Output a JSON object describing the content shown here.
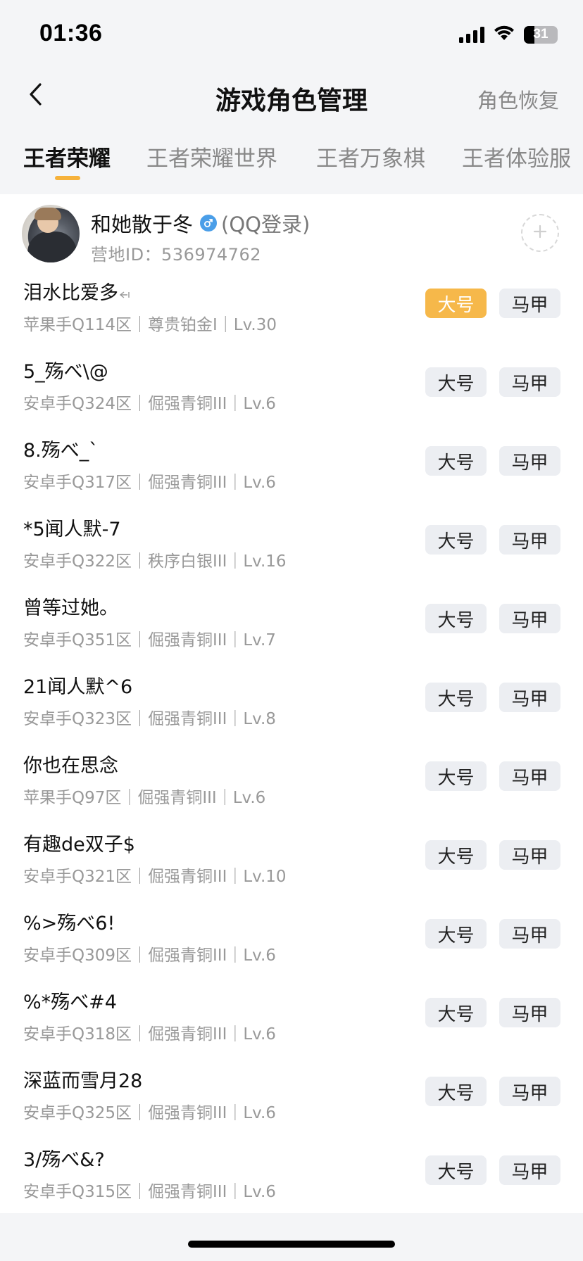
{
  "status_bar": {
    "time": "01:36",
    "battery": "31",
    "battery_level": 0.31,
    "icons": [
      "signal-icon",
      "wifi-icon",
      "battery-icon"
    ]
  },
  "header": {
    "back_icon": "chevron-left-icon",
    "title": "游戏角色管理",
    "right_action": "角色恢复"
  },
  "tabs": [
    {
      "label": "王者荣耀",
      "active": true
    },
    {
      "label": "王者荣耀世界",
      "active": false
    },
    {
      "label": "王者万象棋",
      "active": false
    },
    {
      "label": "王者体验服",
      "active": false
    }
  ],
  "profile": {
    "nickname": "和她散于冬",
    "gender_icon": "male-icon",
    "login_type": "(QQ登录)",
    "camp_id": "营地ID：536974762",
    "add_icon": "plus-icon"
  },
  "labels": {
    "main": "大号",
    "alt": "马甲"
  },
  "colors": {
    "accent": "#f6b84a",
    "tab_indicator": "#f6b23b",
    "gender_icon": "#4a9ee8"
  },
  "roles": [
    {
      "name": "泪水比爱多",
      "meta": "苹果手Q114区｜尊贵铂金I｜Lv.30",
      "main_selected": true
    },
    {
      "name": "5_殇べ\\@",
      "meta": "安卓手Q324区｜倔强青铜III｜Lv.6",
      "main_selected": false
    },
    {
      "name": "8.殇べ_`",
      "meta": "安卓手Q317区｜倔强青铜III｜Lv.6",
      "main_selected": false
    },
    {
      "name": "*5闻人默-7",
      "meta": "安卓手Q322区｜秩序白银III｜Lv.16",
      "main_selected": false
    },
    {
      "name": "曾等过她。",
      "meta": "安卓手Q351区｜倔强青铜III｜Lv.7",
      "main_selected": false
    },
    {
      "name": "21闻人默^6",
      "meta": "安卓手Q323区｜倔强青铜III｜Lv.8",
      "main_selected": false
    },
    {
      "name": "你也在思念",
      "meta": "苹果手Q97区｜倔强青铜III｜Lv.6",
      "main_selected": false
    },
    {
      "name": "有趣de双子$",
      "meta": "安卓手Q321区｜倔强青铜III｜Lv.10",
      "main_selected": false
    },
    {
      "name": "%>殇べ6!",
      "meta": "安卓手Q309区｜倔强青铜III｜Lv.6",
      "main_selected": false
    },
    {
      "name": "%*殇べ#4",
      "meta": "安卓手Q318区｜倔强青铜III｜Lv.6",
      "main_selected": false
    },
    {
      "name": "深蓝而雪月28",
      "meta": "安卓手Q325区｜倔强青铜III｜Lv.6",
      "main_selected": false
    },
    {
      "name": "3/殇べ&?",
      "meta": "安卓手Q315区｜倔强青铜III｜Lv.6",
      "main_selected": false
    }
  ]
}
